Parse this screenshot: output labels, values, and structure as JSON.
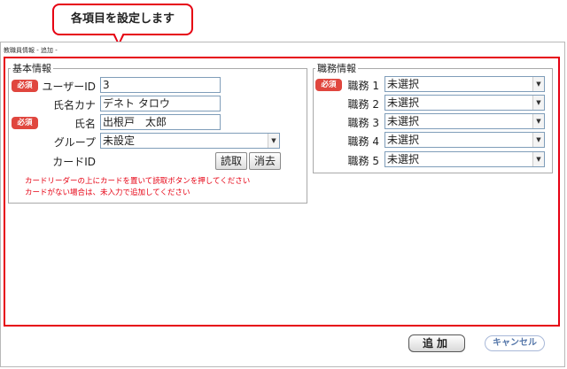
{
  "callout": {
    "text": "各項目を設定します"
  },
  "window": {
    "title": "教職員情報 - 追加 -"
  },
  "basic": {
    "legend": "基本情報",
    "required_badge": "必須",
    "user_id": {
      "label": "ユーザーID",
      "value": "3"
    },
    "name_kana": {
      "label": "氏名カナ",
      "value": "デネト タロウ"
    },
    "name": {
      "label": "氏名",
      "value": "出根戸　太郎"
    },
    "group": {
      "label": "グループ",
      "value": "未設定"
    },
    "card_id": {
      "label": "カードID",
      "value": "",
      "read_button": "読取",
      "clear_button": "消去"
    },
    "note1": "カードリーダーの上にカードを置いて読取ボタンを押してください",
    "note2": "カードがない場合は、未入力で追加してください"
  },
  "job": {
    "legend": "職務情報",
    "required_badge": "必須",
    "rows": [
      {
        "label": "職務 1",
        "value": "未選択"
      },
      {
        "label": "職務 2",
        "value": "未選択"
      },
      {
        "label": "職務 3",
        "value": "未選択"
      },
      {
        "label": "職務 4",
        "value": "未選択"
      },
      {
        "label": "職務 5",
        "value": "未選択"
      }
    ]
  },
  "footer": {
    "add": "追加",
    "cancel": "キャンセル"
  },
  "colors": {
    "accent_red": "#e60012",
    "badge_red": "#e0463e"
  }
}
